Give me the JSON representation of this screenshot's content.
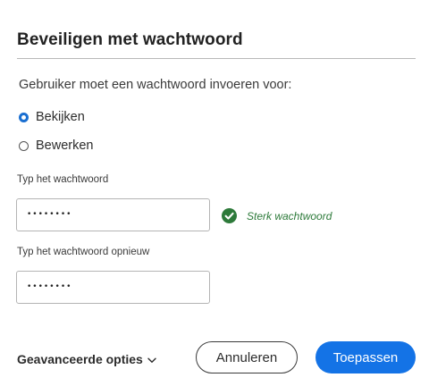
{
  "dialog": {
    "title": "Beveiligen met wachtwoord",
    "instruction": "Gebruiker moet een wachtwoord invoeren voor:",
    "options": [
      {
        "label": "Bekijken",
        "checked": true
      },
      {
        "label": "Bewerken",
        "checked": false
      }
    ],
    "password": {
      "label": "Typ het wachtwoord",
      "value": "••••••••"
    },
    "strength": {
      "text": "Sterk wachtwoord",
      "icon": "check-circle-icon",
      "color": "#2d7a3a"
    },
    "confirm": {
      "label": "Typ het wachtwoord opnieuw",
      "value": "••••••••"
    },
    "footer": {
      "advanced_label": "Geavanceerde opties",
      "cancel_label": "Annuleren",
      "apply_label": "Toepassen"
    },
    "colors": {
      "accent": "#1473e6",
      "radio_selected": "#1a6fd1"
    }
  }
}
